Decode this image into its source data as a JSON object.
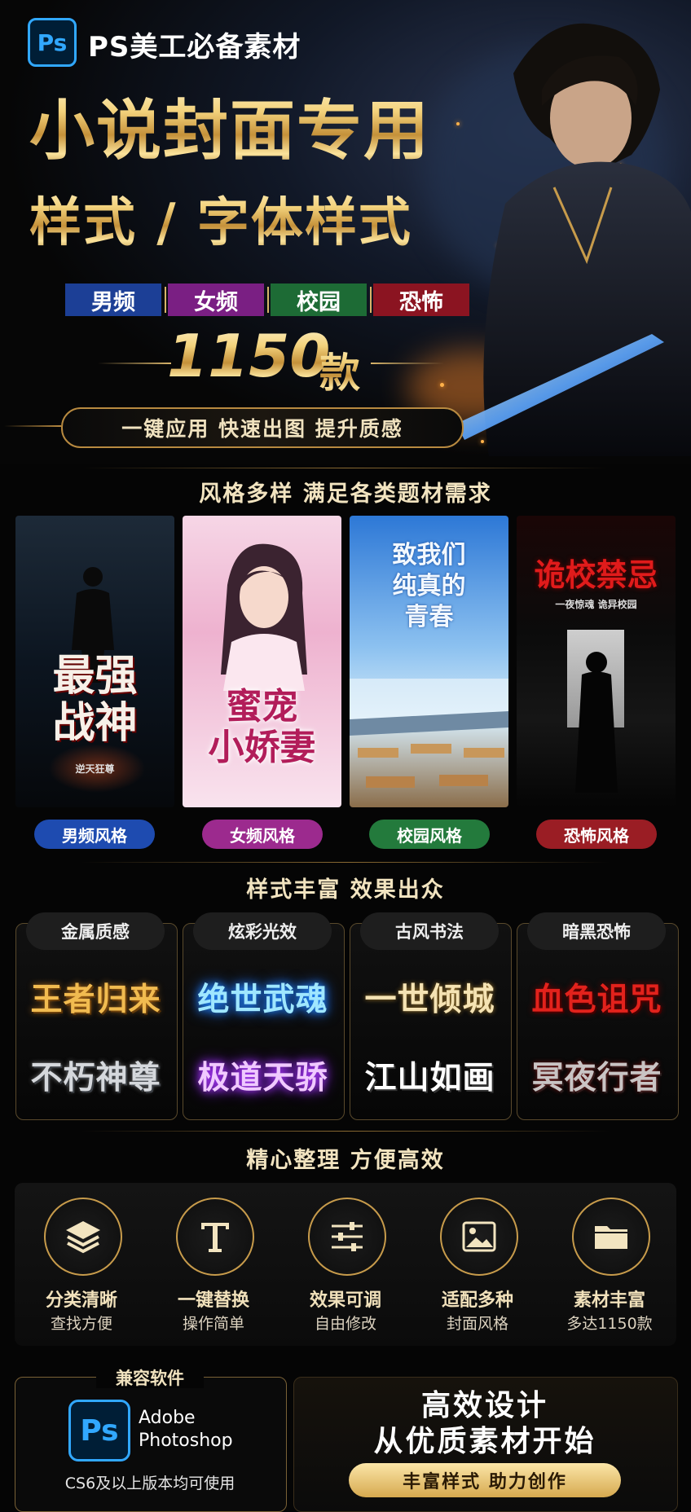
{
  "header": {
    "logo_text": "Ps",
    "brand_title": "PS美工必备素材",
    "title_line1": "小说封面专用",
    "title_line2": "样式 / 字体样式",
    "tags": [
      {
        "label": "男频",
        "color": "#1c3f96"
      },
      {
        "label": "女频",
        "color": "#7a1f83"
      },
      {
        "label": "校园",
        "color": "#1d6b35"
      },
      {
        "label": "恐怖",
        "color": "#8b1421"
      }
    ],
    "count_number": "1150",
    "count_unit": "款",
    "capsule_text": "一键应用  快速出图  提升质感"
  },
  "styles_section": {
    "heading": "风格多样  满足各类题材需求",
    "cards": [
      {
        "title": "最强\n战神",
        "subtitle": "逆天狂尊",
        "pill": "男频风格",
        "pill_color": "#1e4bb0"
      },
      {
        "title": "蜜宠\n小娇妻",
        "subtitle": "",
        "pill": "女频风格",
        "pill_color": "#9c2a8e"
      },
      {
        "title": "致我们\n纯真的\n青春",
        "subtitle": "",
        "pill": "校园风格",
        "pill_color": "#237a3c"
      },
      {
        "title": "诡校禁忌",
        "subtitle": "一夜惊魂 诡异校园",
        "pill": "恐怖风格",
        "pill_color": "#9a1d24"
      }
    ]
  },
  "effects_section": {
    "heading": "样式丰富  效果出众",
    "panels": [
      {
        "label": "金属质感",
        "line1": "王者归来",
        "line2": "不朽神尊"
      },
      {
        "label": "炫彩光效",
        "line1": "绝世武魂",
        "line2": "极道天骄"
      },
      {
        "label": "古风书法",
        "line1": "一世倾城",
        "line2": "江山如画"
      },
      {
        "label": "暗黑恐怖",
        "line1": "血色诅咒",
        "line2": "冥夜行者"
      }
    ]
  },
  "features_section": {
    "heading": "精心整理  方便高效",
    "items": [
      {
        "icon": "layers-icon",
        "title": "分类清晰",
        "desc": "查找方便"
      },
      {
        "icon": "text-icon",
        "title": "一键替换",
        "desc": "操作简单"
      },
      {
        "icon": "sliders-icon",
        "title": "效果可调",
        "desc": "自由修改"
      },
      {
        "icon": "image-icon",
        "title": "适配多种",
        "desc": "封面风格"
      },
      {
        "icon": "folder-icon",
        "title": "素材丰富",
        "desc": "多达1150款"
      }
    ]
  },
  "compat": {
    "label": "兼容软件",
    "logo_text": "Ps",
    "app_line1": "Adobe",
    "app_line2": "Photoshop",
    "note": "CS6及以上版本均可使用"
  },
  "slogan": {
    "line1": "高效设计",
    "line2": "从优质素材开始",
    "button": "丰富样式  助力创作"
  }
}
